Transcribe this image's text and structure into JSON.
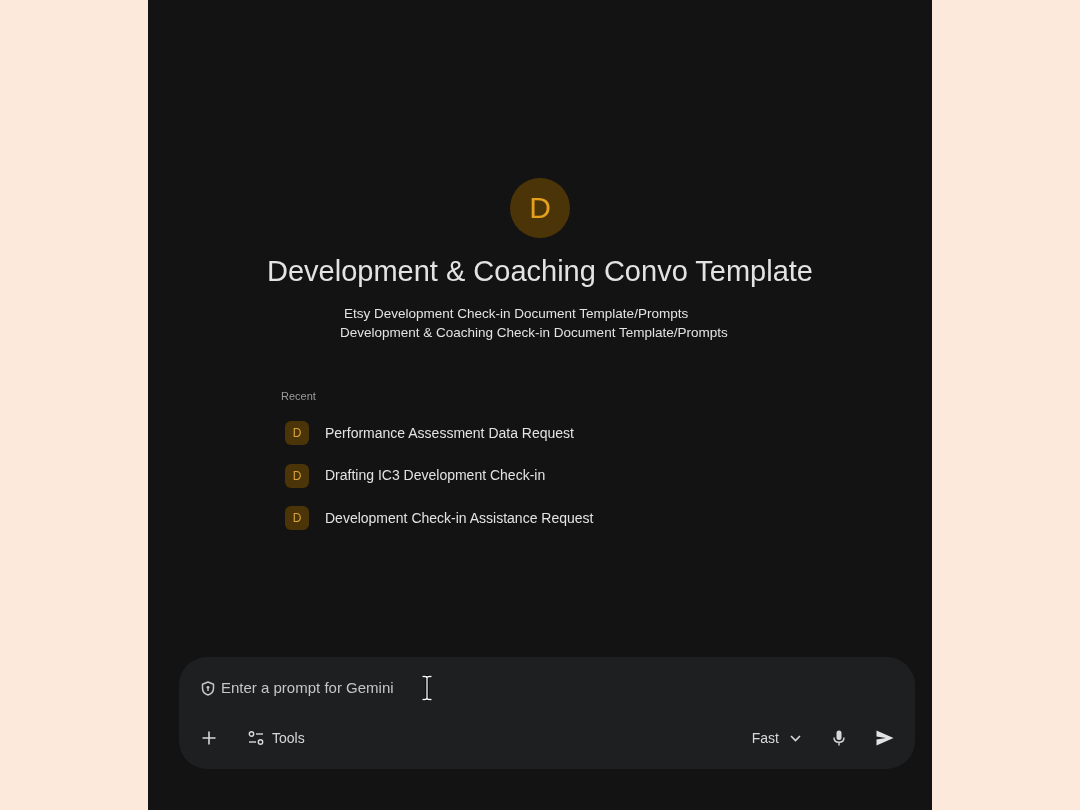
{
  "assistant": {
    "initial": "D",
    "title": "Development & Coaching Convo Template",
    "description_lines": [
      "Etsy Development Check-in Document Template/Prompts",
      "Development & Coaching Check-in Document Template/Prompts"
    ]
  },
  "recent": {
    "heading": "Recent",
    "items": [
      {
        "initial": "D",
        "title": "Performance Assessment Data Request"
      },
      {
        "initial": "D",
        "title": "Drafting IC3 Development Check-in"
      },
      {
        "initial": "D",
        "title": "Development Check-in Assistance Request"
      }
    ]
  },
  "prompt": {
    "placeholder": "Enter a prompt for Gemini"
  },
  "toolbar": {
    "tools_label": "Tools",
    "mode": "Fast"
  }
}
